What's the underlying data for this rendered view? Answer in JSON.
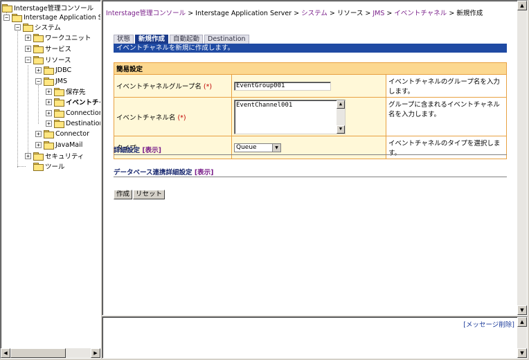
{
  "tree": {
    "root": "Interstage管理コンソール",
    "server": "Interstage Application Server",
    "system": "システム",
    "work_unit": "ワークユニット",
    "service": "サービス",
    "resource": "リソース",
    "jdbc": "JDBC",
    "jms": "JMS",
    "storage": "保存先",
    "event_channel": "イベントチャネ",
    "connection_factory": "ConnectionFac",
    "destination": "Destination",
    "connector": "Connector",
    "javamail": "JavaMail",
    "security": "セキュリティ",
    "tool": "ツール",
    "expand_plus": "+",
    "expand_minus": "−"
  },
  "breadcrumb": {
    "console": "Interstage管理コンソール",
    "sep1": " > ",
    "server": "Interstage Application Server",
    "sep2": " > ",
    "system": "システム",
    "sep3": " > ",
    "resource": "リソース",
    "sep4": " > ",
    "jms": "JMS",
    "sep5": " > ",
    "event_channel": "イベントチャネル",
    "sep6": " > ",
    "current": "新規作成"
  },
  "tabs": [
    {
      "label": "状態"
    },
    {
      "label": "新規作成"
    },
    {
      "label": "自動起動"
    },
    {
      "label": "Destination"
    }
  ],
  "description": "イベントチャネルを新規に作成します。",
  "form": {
    "header": "簡易設定",
    "required_mark": "(*)",
    "group_name_label": "イベントチャネルグループ名",
    "group_name_value": "EventGroup001",
    "group_name_hint": "イベントチャネルのグループ名を入力します。",
    "channel_name_label": "イベントチャネル名",
    "channel_name_value": "EventChannel001",
    "channel_name_hint": "グループに含まれるイベントチャネル名を入力します。",
    "type_label": "タイプ",
    "type_value": "Queue",
    "type_hint": "イベントチャネルのタイプを選択します。"
  },
  "sections": {
    "detail": "詳細設定",
    "detail_link": "[表示]",
    "db": "データベース連携詳細設定",
    "db_link": "[表示]"
  },
  "buttons": {
    "create": "作成",
    "reset": "リセット"
  },
  "messages": {
    "delete_link": "[メッセージ削除]"
  },
  "icons": {
    "up": "▲",
    "down": "▼",
    "left": "◀",
    "right": "▶"
  },
  "colors": {
    "tab_active": "#1a3a8a",
    "desc_bar": "#1f4aa3",
    "table_border": "#e8a040",
    "table_header": "#fcd890",
    "link": "#7a1f8a"
  }
}
